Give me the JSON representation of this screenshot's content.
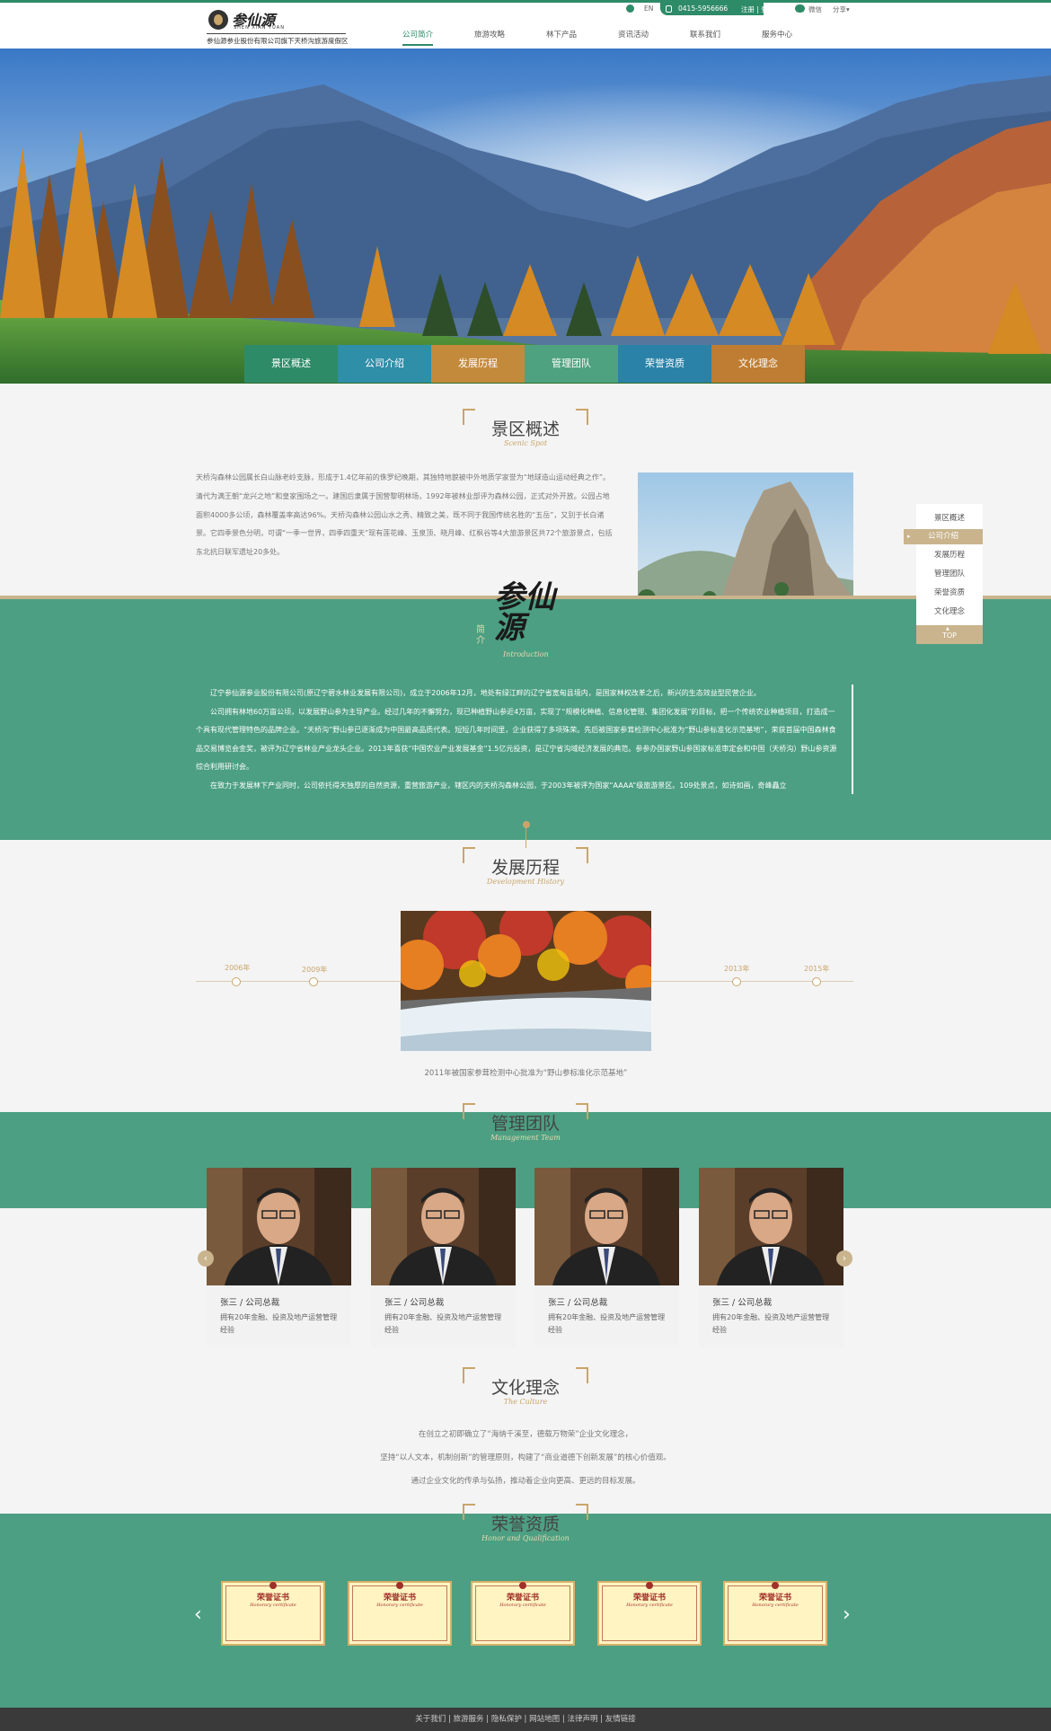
{
  "header": {
    "logo_cn": "参仙源",
    "logo_en": "SHEN XIAN YUAN",
    "logo_sub": "参仙源参业股份有限公司旗下天桥沟旅游度假区",
    "lang": "EN",
    "phone": "0415-5956666",
    "register": "注册",
    "login": "登录",
    "wechat": "微信",
    "share": "分享"
  },
  "nav": [
    {
      "label": "公司简介",
      "active": true
    },
    {
      "label": "旅游攻略"
    },
    {
      "label": "林下产品"
    },
    {
      "label": "资讯活动"
    },
    {
      "label": "联系我们"
    },
    {
      "label": "服务中心"
    }
  ],
  "tabs": [
    {
      "label": "景区概述",
      "color": "#2e8b68"
    },
    {
      "label": "公司介绍",
      "color": "#2f8ea8"
    },
    {
      "label": "发展历程",
      "color": "#c48a3c"
    },
    {
      "label": "管理团队",
      "color": "#4ea27f"
    },
    {
      "label": "荣誉资质",
      "color": "#2a82a8"
    },
    {
      "label": "文化理念",
      "color": "#be7d32"
    }
  ],
  "scenic": {
    "title": "景区概述",
    "subtitle": "Scenic Spot",
    "text": "天桥沟森林公园属长白山脉老岭支脉，形成于1.4亿年前的侏罗纪晚期，其独特地貌被中外地质学家誉为“地球造山运动经典之作”。清代为满王朝“龙兴之地”和皇家围场之一。建国后隶属于国营黎明林场，1992年被林业部评为森林公园，正式对外开放。公园占地面积4000多公顷，森林覆盖率高达96%。天桥沟森林公园山水之秀、精致之美，既不同于我国传统名胜的“五岳”，又别于长白诸景。它四季景色分明，可谓“一季一世界，四季四重天”现有莲花峰、玉泉顶、晓月峰、红枫谷等4大旅游景区共72个旅游景点，包括东北抗日联军遗址20多处。"
  },
  "intro": {
    "logo": "参仙源",
    "tag": "简介",
    "subtitle": "Introduction",
    "p1": "辽宁参仙源参业股份有限公司(原辽宁碧水林业发展有限公司)，成立于2006年12月，地处有绿江畔的辽宁省宽甸县境内，是国家林权改革之后，新兴的生态效益型民营企业。",
    "p2": "公司拥有林地60万亩公顷，以发展野山参为主导产业。经过几年的不懈努力，现已种植野山参近4万亩，实现了“规模化种植、信息化管理、集团化发展”的目标，把一个传统农业种植项目，打造成一个具有现代管理特色的品牌企业。“天桥沟”野山参已逐渐成为中国最高品质代表。短短几年时间里，企业获得了多项殊荣。先后被国家参茸检测中心批准为“野山参标准化示范基地”，荣获首届中国森林食品交易博览会金奖，被评为辽宁省林业产业龙头企业。2013年喜获“中国农业产业发展基金”1.5亿元投资，是辽宁省沟域经济发展的典范。参参办国家野山参国家标准审定会和中国（天桥沟）野山参资源综合利用研讨会。",
    "p3": "在致力于发展林下产业同时，公司依托得天独厚的自然资源，重营旅游产业，辖区内的天桥沟森林公园，于2003年被评为国家“AAAA”级旅游景区。109处景点，如诗如画，奇峰矗立"
  },
  "history": {
    "title": "发展历程",
    "subtitle": "Development History",
    "years": [
      "2006年",
      "2009年",
      "2013年",
      "2015年"
    ],
    "caption": "2011年被国家参茸检测中心批准为“野山参标准化示范基地”"
  },
  "team": {
    "title": "管理团队",
    "subtitle": "Management Team",
    "members": [
      {
        "name": "张三 / 公司总裁",
        "desc": "拥有20年金融、投资及地产运营管理经验"
      },
      {
        "name": "张三 / 公司总裁",
        "desc": "拥有20年金融、投资及地产运营管理经验"
      },
      {
        "name": "张三 / 公司总裁",
        "desc": "拥有20年金融、投资及地产运营管理经验"
      },
      {
        "name": "张三 / 公司总裁",
        "desc": "拥有20年金融、投资及地产运营管理经验"
      }
    ]
  },
  "culture": {
    "title": "文化理念",
    "subtitle": "The Culture",
    "lines": [
      "在创立之初即确立了“海纳千溪至，德载万物荣”企业文化理念，",
      "坚持“以人文本，机制创新”的管理原则，构建了“商业道德下创新发展”的核心价值观。",
      "通过企业文化的传承与弘扬，推动着企业向更高、更远的目标发展。"
    ]
  },
  "honor": {
    "title": "荣誉资质",
    "subtitle": "Honor and Qualification",
    "cert_title": "荣誉证书",
    "cert_en": "Honorary certificate",
    "count": 5
  },
  "side": {
    "items": [
      "景区概述",
      "公司介绍",
      "发展历程",
      "管理团队",
      "荣誉资质",
      "文化理念"
    ],
    "active": 1,
    "top": "TOP"
  },
  "footer": {
    "links": [
      "关于我们",
      "旅游服务",
      "隐私保护",
      "网站地图",
      "法律声明",
      "友情链接"
    ]
  }
}
